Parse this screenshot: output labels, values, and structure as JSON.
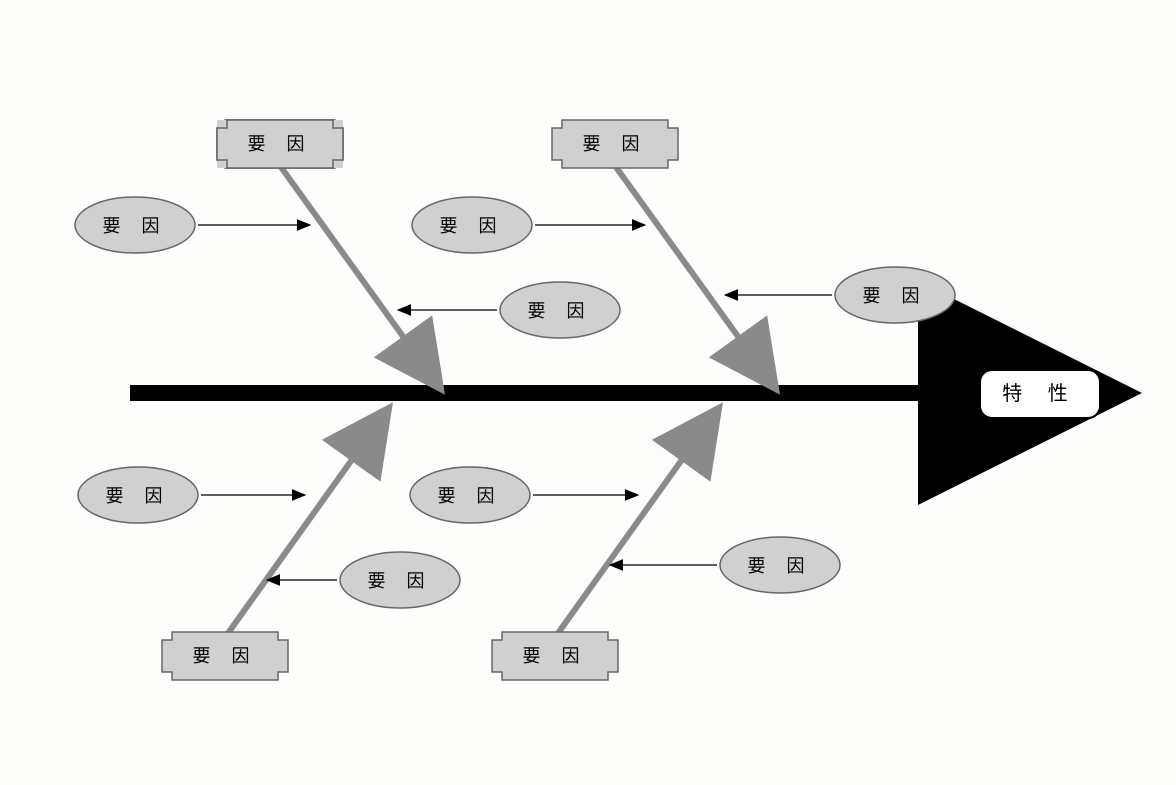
{
  "diagram": {
    "type": "fishbone",
    "effect": {
      "label": "特 性"
    },
    "categories": {
      "top_left": {
        "label": "要 因"
      },
      "top_right": {
        "label": "要 因"
      },
      "bottom_left": {
        "label": "要 因"
      },
      "bottom_right": {
        "label": "要 因"
      }
    },
    "sub_causes": {
      "top_left_a": {
        "label": "要 因"
      },
      "top_left_b": {
        "label": "要 因"
      },
      "top_right_a": {
        "label": "要 因"
      },
      "top_right_b": {
        "label": "要 因"
      },
      "bottom_left_a": {
        "label": "要 因"
      },
      "bottom_left_b": {
        "label": "要 因"
      },
      "bottom_right_a": {
        "label": "要 因"
      },
      "bottom_right_b": {
        "label": "要 因"
      }
    }
  }
}
